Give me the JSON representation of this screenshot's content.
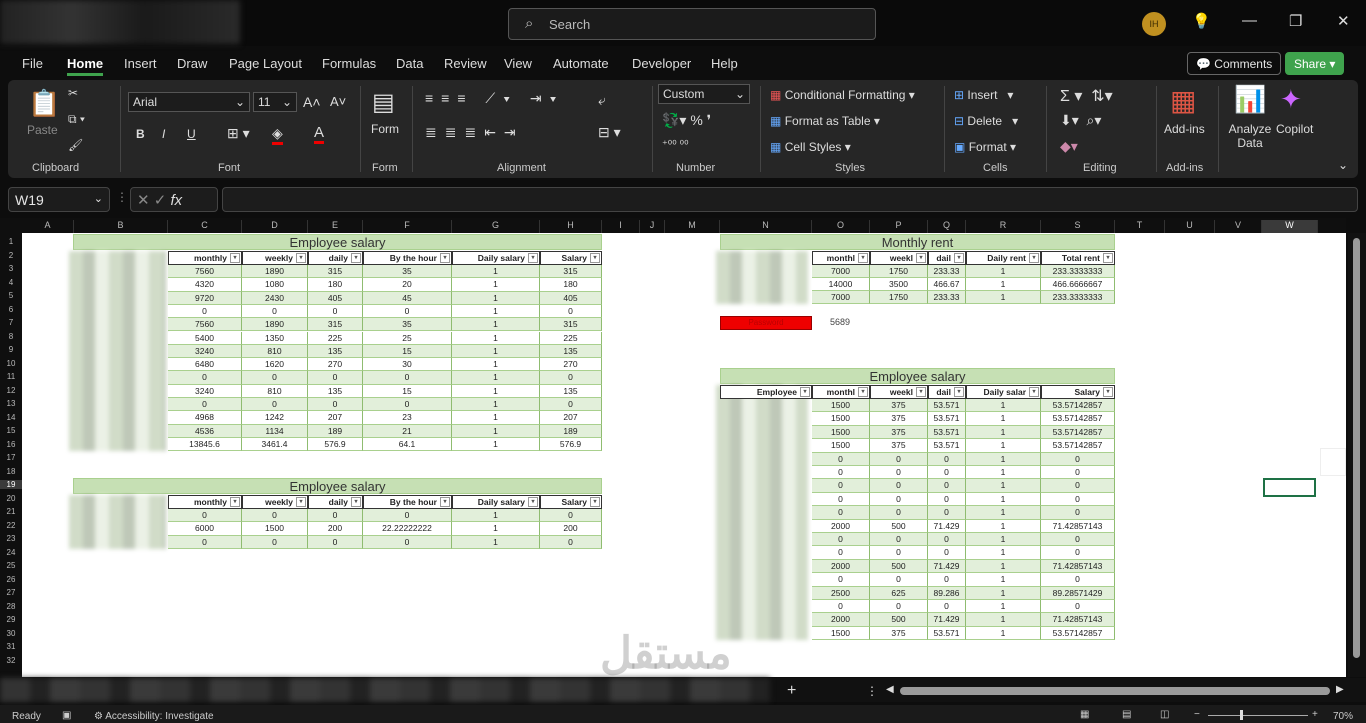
{
  "title_bar": {
    "search_placeholder": "Search",
    "avatar_initials": "IH",
    "minimize": "—",
    "maximize": "❐",
    "close": "✕",
    "lightbulb": "💡"
  },
  "menu": {
    "tabs": [
      "File",
      "Home",
      "Insert",
      "Draw",
      "Page Layout",
      "Formulas",
      "Data",
      "Review",
      "View",
      "Automate",
      "Developer",
      "Help"
    ],
    "active": "Home",
    "comments": "Comments",
    "share": "Share"
  },
  "ribbon": {
    "clipboard": {
      "label": "Clipboard",
      "paste": "Paste"
    },
    "font": {
      "label": "Font",
      "family": "Arial",
      "size": "11",
      "bold": "B",
      "italic": "I",
      "underline": "U"
    },
    "form": {
      "label": "Form",
      "button": "Form"
    },
    "alignment": {
      "label": "Alignment"
    },
    "number": {
      "label": "Number",
      "format": "Custom"
    },
    "styles": {
      "label": "Styles",
      "conditional": "Conditional Formatting",
      "format_table": "Format as Table",
      "cell_styles": "Cell Styles"
    },
    "cells": {
      "label": "Cells",
      "insert": "Insert",
      "delete": "Delete",
      "format": "Format"
    },
    "editing": {
      "label": "Editing"
    },
    "addins": {
      "label": "Add-ins",
      "button": "Add-ins"
    },
    "analyze": {
      "button": "Analyze Data"
    },
    "copilot": {
      "button": "Copilot"
    }
  },
  "formula_bar": {
    "name_box": "W19",
    "fx": "fx",
    "value": ""
  },
  "columns": [
    "A",
    "B",
    "C",
    "D",
    "E",
    "F",
    "G",
    "H",
    "I",
    "J",
    "M",
    "N",
    "O",
    "P",
    "Q",
    "R",
    "S",
    "T",
    "U",
    "V",
    "W"
  ],
  "rows": [
    "1",
    "2",
    "3",
    "4",
    "5",
    "6",
    "7",
    "8",
    "9",
    "10",
    "11",
    "12",
    "13",
    "14",
    "15",
    "16",
    "17",
    "18",
    "19",
    "20",
    "21",
    "22",
    "23",
    "24",
    "25",
    "26",
    "27",
    "28",
    "29",
    "30",
    "31",
    "32"
  ],
  "table1": {
    "title": "Employee salary",
    "headers": [
      "monthly",
      "weekly",
      "daily",
      "By the hour",
      "Daily salary",
      "Salary"
    ],
    "rows": [
      [
        "7560",
        "1890",
        "315",
        "35",
        "1",
        "315"
      ],
      [
        "4320",
        "1080",
        "180",
        "20",
        "1",
        "180"
      ],
      [
        "9720",
        "2430",
        "405",
        "45",
        "1",
        "405"
      ],
      [
        "0",
        "0",
        "0",
        "0",
        "1",
        "0"
      ],
      [
        "7560",
        "1890",
        "315",
        "35",
        "1",
        "315"
      ],
      [
        "5400",
        "1350",
        "225",
        "25",
        "1",
        "225"
      ],
      [
        "3240",
        "810",
        "135",
        "15",
        "1",
        "135"
      ],
      [
        "6480",
        "1620",
        "270",
        "30",
        "1",
        "270"
      ],
      [
        "0",
        "0",
        "0",
        "0",
        "1",
        "0"
      ],
      [
        "3240",
        "810",
        "135",
        "15",
        "1",
        "135"
      ],
      [
        "0",
        "0",
        "0",
        "0",
        "1",
        "0"
      ],
      [
        "4968",
        "1242",
        "207",
        "23",
        "1",
        "207"
      ],
      [
        "4536",
        "1134",
        "189",
        "21",
        "1",
        "189"
      ],
      [
        "13845.6",
        "3461.4",
        "576.9",
        "64.1",
        "1",
        "576.9"
      ]
    ]
  },
  "table2": {
    "title": "Employee salary",
    "headers": [
      "monthly",
      "weekly",
      "daily",
      "By the hour",
      "Daily salary",
      "Salary"
    ],
    "rows": [
      [
        "0",
        "0",
        "0",
        "0",
        "1",
        "0"
      ],
      [
        "6000",
        "1500",
        "200",
        "22.22222222",
        "1",
        "200"
      ],
      [
        "0",
        "0",
        "0",
        "0",
        "1",
        "0"
      ]
    ]
  },
  "rent": {
    "title": "Monthly rent",
    "headers": [
      "monthl",
      "weekl",
      "dail",
      "Daily rent",
      "Total rent"
    ],
    "rows": [
      [
        "7000",
        "1750",
        "233.33",
        "1",
        "233.3333333"
      ],
      [
        "14000",
        "3500",
        "466.67",
        "1",
        "466.6666667"
      ],
      [
        "7000",
        "1750",
        "233.33",
        "1",
        "233.3333333"
      ]
    ],
    "password_label": "Password",
    "password_value": "5689"
  },
  "table3": {
    "title": "Employee salary",
    "headers": [
      "Employee",
      "monthl",
      "weekl",
      "dail",
      "Daily salar",
      "Salary"
    ],
    "rows": [
      [
        "1500",
        "375",
        "53.571",
        "1",
        "53.57142857"
      ],
      [
        "1500",
        "375",
        "53.571",
        "1",
        "53.57142857"
      ],
      [
        "1500",
        "375",
        "53.571",
        "1",
        "53.57142857"
      ],
      [
        "1500",
        "375",
        "53.571",
        "1",
        "53.57142857"
      ],
      [
        "0",
        "0",
        "0",
        "1",
        "0"
      ],
      [
        "0",
        "0",
        "0",
        "1",
        "0"
      ],
      [
        "0",
        "0",
        "0",
        "1",
        "0"
      ],
      [
        "0",
        "0",
        "0",
        "1",
        "0"
      ],
      [
        "0",
        "0",
        "0",
        "1",
        "0"
      ],
      [
        "2000",
        "500",
        "71.429",
        "1",
        "71.42857143"
      ],
      [
        "0",
        "0",
        "0",
        "1",
        "0"
      ],
      [
        "0",
        "0",
        "0",
        "1",
        "0"
      ],
      [
        "2000",
        "500",
        "71.429",
        "1",
        "71.42857143"
      ],
      [
        "0",
        "0",
        "0",
        "1",
        "0"
      ],
      [
        "2500",
        "625",
        "89.286",
        "1",
        "89.28571429"
      ],
      [
        "0",
        "0",
        "0",
        "1",
        "0"
      ],
      [
        "2000",
        "500",
        "71.429",
        "1",
        "71.42857143"
      ],
      [
        "1500",
        "375",
        "53.571",
        "1",
        "53.57142857"
      ]
    ]
  },
  "status": {
    "ready": "Ready",
    "accessibility": "Accessibility: Investigate",
    "zoom": "70%"
  },
  "sheet_tabs": {
    "add": "+"
  }
}
